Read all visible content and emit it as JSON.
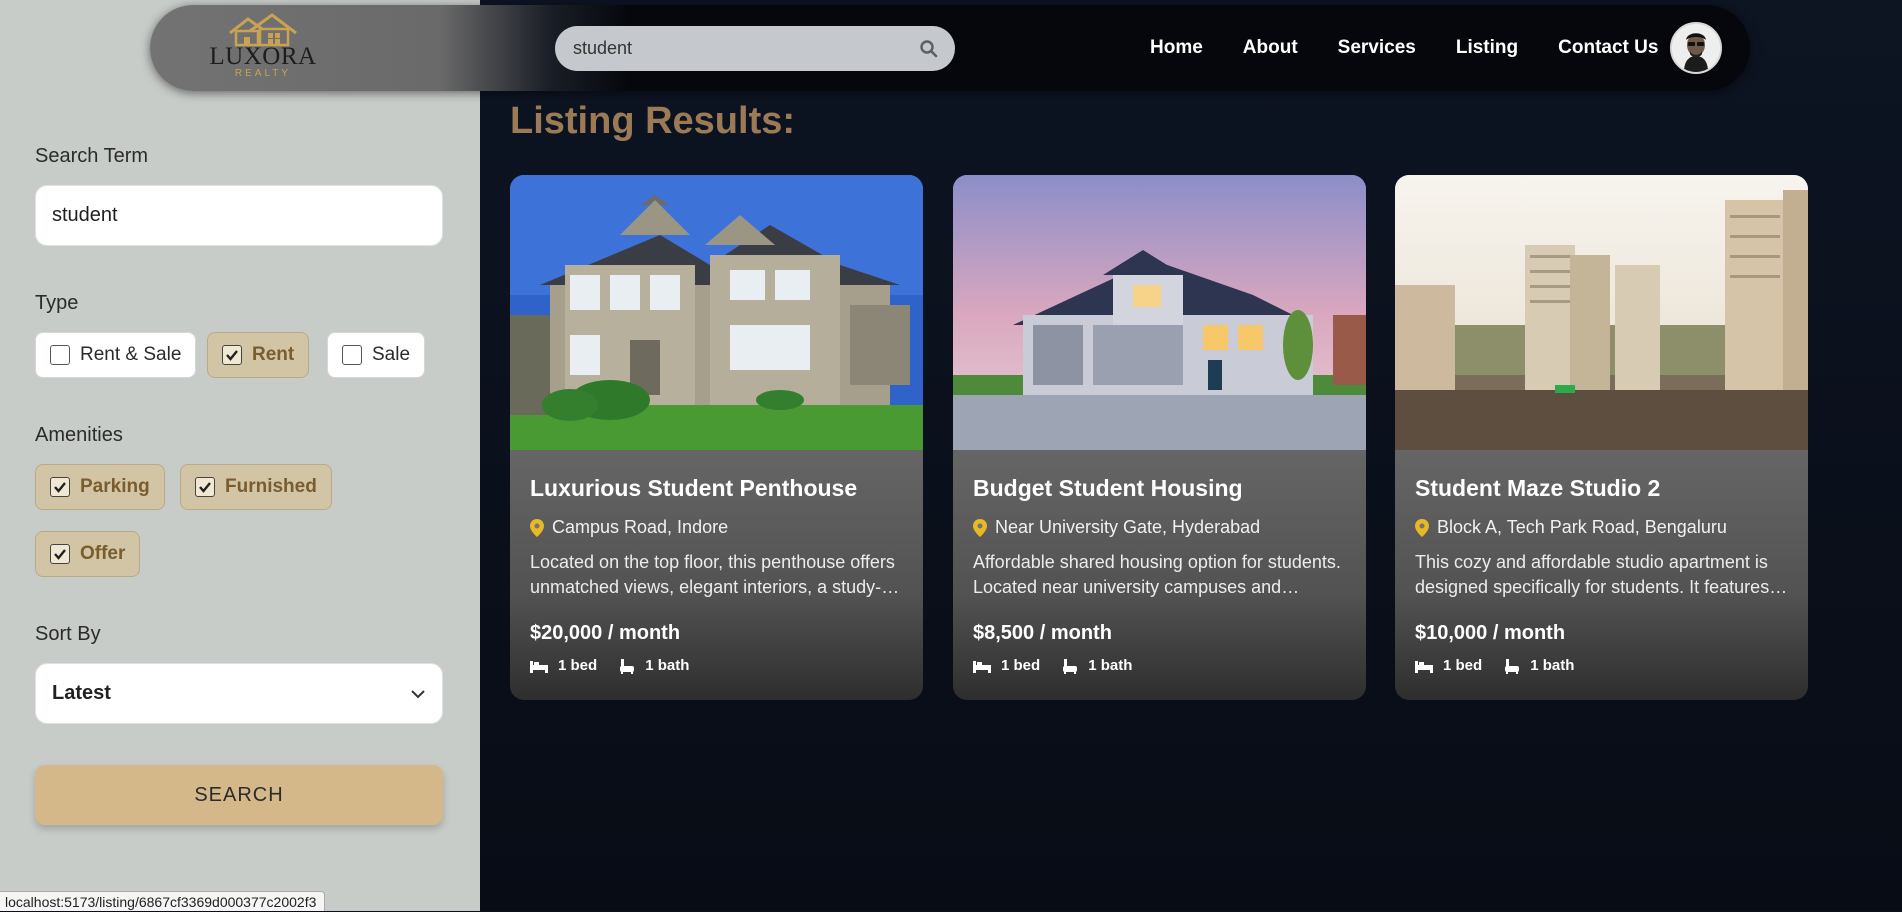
{
  "header": {
    "logo": {
      "name": "LUXORA",
      "tagline": "REALTY"
    },
    "search": {
      "value": "student"
    },
    "nav": [
      "Home",
      "About",
      "Services",
      "Listing",
      "Contact Us"
    ]
  },
  "sidebar": {
    "search_term": {
      "label": "Search Term",
      "value": "student"
    },
    "type": {
      "label": "Type",
      "options": [
        {
          "label": "Rent & Sale",
          "checked": false
        },
        {
          "label": "Rent",
          "checked": true
        },
        {
          "label": "Sale",
          "checked": false
        }
      ]
    },
    "amenities": {
      "label": "Amenities",
      "options": [
        {
          "label": "Parking",
          "checked": true
        },
        {
          "label": "Furnished",
          "checked": true
        },
        {
          "label": "Offer",
          "checked": true
        }
      ]
    },
    "sort": {
      "label": "Sort By",
      "value": "Latest"
    },
    "search_button": "SEARCH"
  },
  "main": {
    "title": "Listing Results:",
    "listings": [
      {
        "title": "Luxurious Student Penthouse",
        "location": "Campus Road, Indore",
        "description": "Located on the top floor, this penthouse offers unmatched views, elegant interiors, a study-oriented layout and premium amenities.",
        "price": "$20,000 / month",
        "beds": "1 bed",
        "baths": "1 bath"
      },
      {
        "title": "Budget Student Housing",
        "location": "Near University Gate, Hyderabad",
        "description": "Affordable shared housing option for students. Located near university campuses and libraries, with easy transport access.",
        "price": "$8,500 / month",
        "beds": "1 bed",
        "baths": "1 bath"
      },
      {
        "title": "Student Maze Studio 2",
        "location": "Block A, Tech Park Road, Bengaluru",
        "description": "This cozy and affordable studio apartment is designed specifically for students. It features a compact kitchenette and study desk.",
        "price": "$10,000 / month",
        "beds": "1 bed",
        "baths": "1 bath"
      }
    ]
  },
  "status_bar": {
    "url": "localhost:5173/listing/6867cf3369d000377c2002f3"
  },
  "colors": {
    "accent_gold": "#d4b88a",
    "title_brown": "#9c7a55",
    "pin_yellow": "#e8b923",
    "sidebar_bg": "#c8ccc9",
    "main_bg": "#0a0f19"
  }
}
